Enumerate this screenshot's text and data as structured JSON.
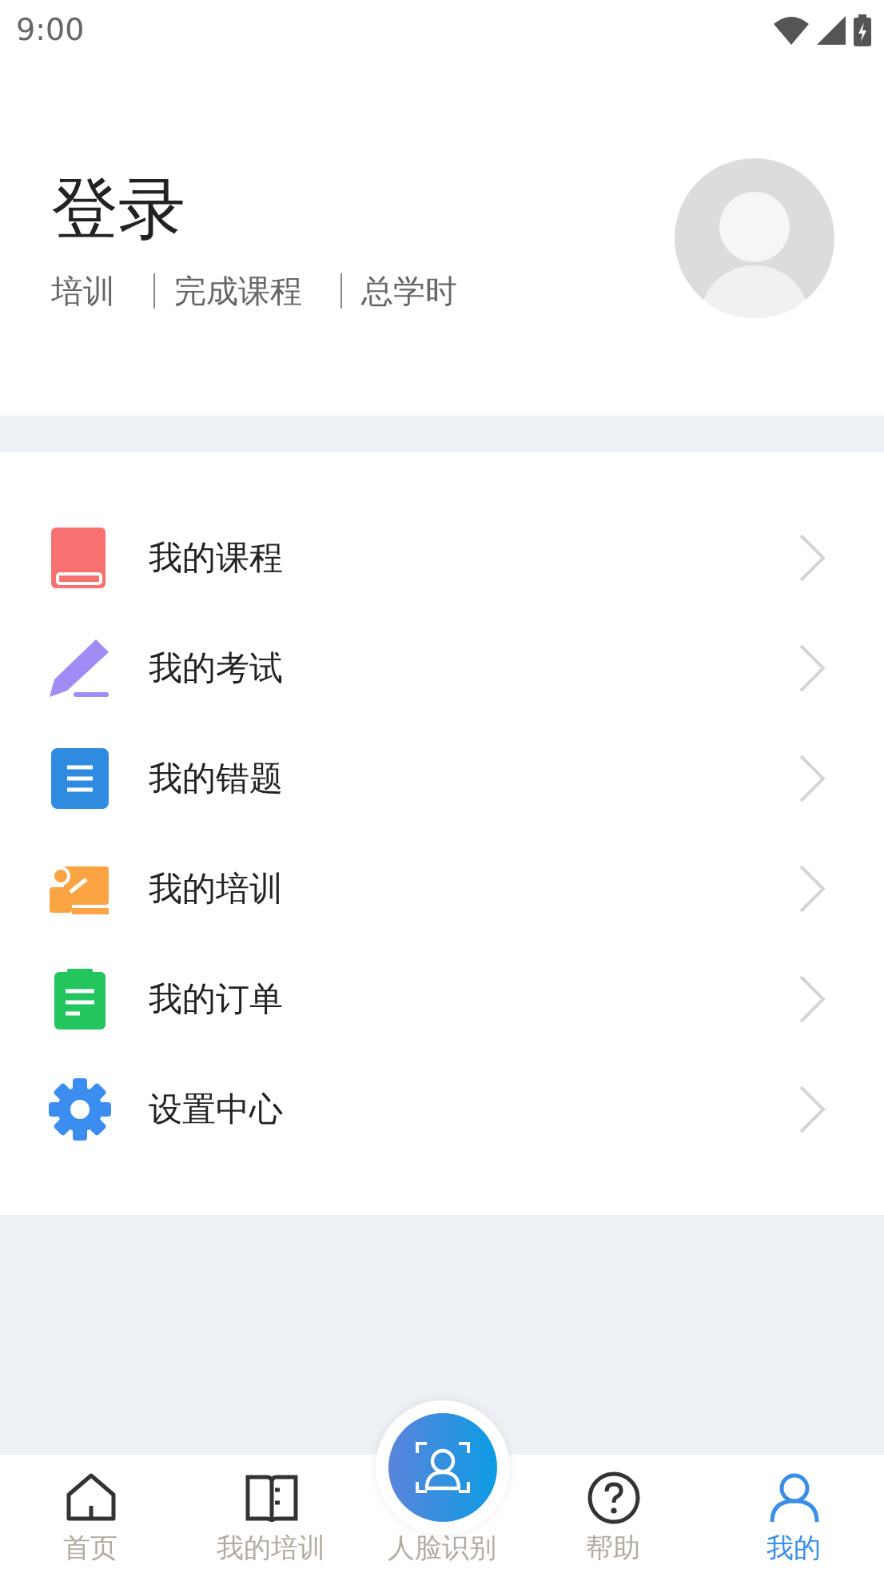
{
  "status_bar": {
    "time": "9:00"
  },
  "profile": {
    "title": "登录",
    "stats": [
      "培训",
      "完成课程",
      "总学时"
    ]
  },
  "menu": [
    {
      "label": "我的课程",
      "kind": "book"
    },
    {
      "label": "我的考试",
      "kind": "pencil"
    },
    {
      "label": "我的错题",
      "kind": "list"
    },
    {
      "label": "我的培训",
      "kind": "teach"
    },
    {
      "label": "我的订单",
      "kind": "clipboard"
    },
    {
      "label": "设置中心",
      "kind": "gear"
    }
  ],
  "tab_bar": [
    {
      "label": "首页",
      "kind": "home",
      "selected": false
    },
    {
      "label": "我的培训",
      "kind": "book",
      "selected": false
    },
    {
      "label": "人脸识别",
      "kind": "face",
      "selected": false
    },
    {
      "label": "帮助",
      "kind": "help",
      "selected": false
    },
    {
      "label": "我的",
      "kind": "user",
      "selected": true
    }
  ]
}
